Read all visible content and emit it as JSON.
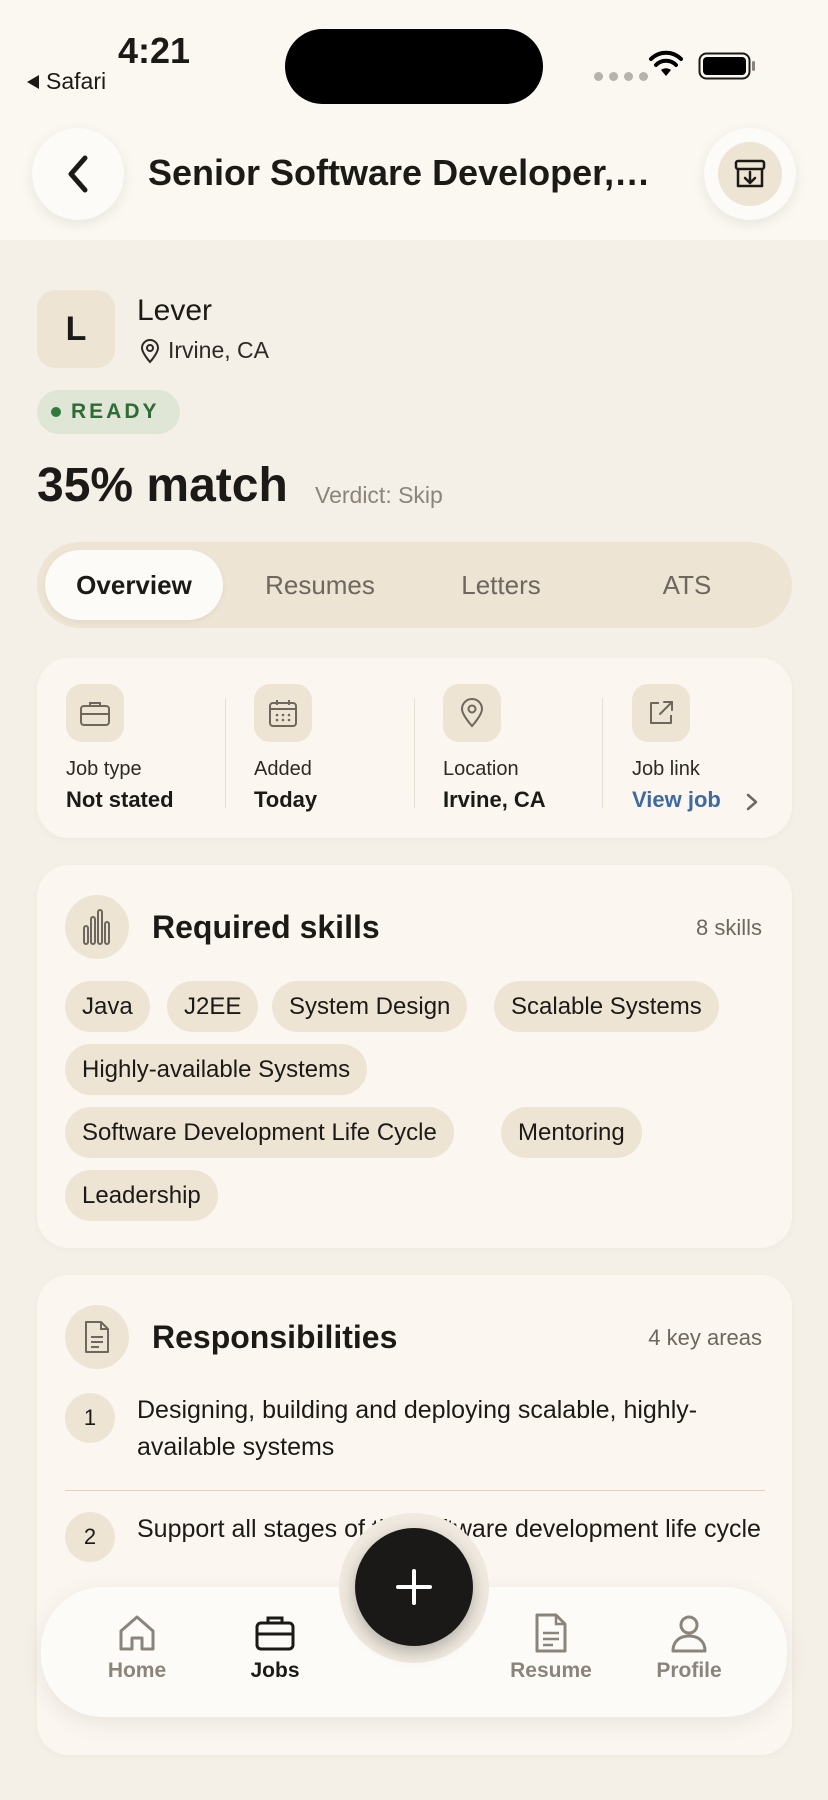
{
  "status_bar": {
    "time": "4:21",
    "back_app": "Safari"
  },
  "header": {
    "title": "Senior Software Developer,…"
  },
  "company": {
    "initial": "L",
    "name": "Lever",
    "location": "Irvine, CA"
  },
  "status_badge": "READY",
  "match": {
    "text": "35% match",
    "verdict": "Verdict: Skip",
    "percent": 35
  },
  "tabs": [
    {
      "label": "Overview",
      "active": true
    },
    {
      "label": "Resumes"
    },
    {
      "label": "Letters"
    },
    {
      "label": "ATS"
    }
  ],
  "info": [
    {
      "icon": "briefcase-icon",
      "label": "Job type",
      "value": "Not stated"
    },
    {
      "icon": "calendar-icon",
      "label": "Added",
      "value": "Today"
    },
    {
      "icon": "location-pin-icon",
      "label": "Location",
      "value": "Irvine, CA"
    },
    {
      "icon": "external-link-icon",
      "label": "Job link",
      "value": "View job"
    }
  ],
  "skills": {
    "title": "Required skills",
    "count": "8 skills",
    "items": [
      "Java",
      "J2EE",
      "System Design",
      "Scalable Systems",
      "Highly-available Systems",
      "Software Development Life Cycle",
      "Mentoring",
      "Leadership"
    ]
  },
  "responsibilities": {
    "title": "Responsibilities",
    "count": "4 key areas",
    "items": [
      {
        "num": "1",
        "text": "Designing, building and deploying scalable, highly-available systems"
      },
      {
        "num": "2",
        "text": "Support all stages of the software development life cycle"
      }
    ]
  },
  "bottom_nav": [
    {
      "label": "Home",
      "icon": "home-icon"
    },
    {
      "label": "Jobs",
      "icon": "briefcase-icon",
      "active": true
    },
    {
      "label": "Resume",
      "icon": "document-icon"
    },
    {
      "label": "Profile",
      "icon": "person-icon"
    }
  ],
  "colors": {
    "background": "#f5f0e7",
    "accent_dark": "#1a1917",
    "ready_green": "#2f6b35",
    "link_blue": "#3f6aa1"
  }
}
